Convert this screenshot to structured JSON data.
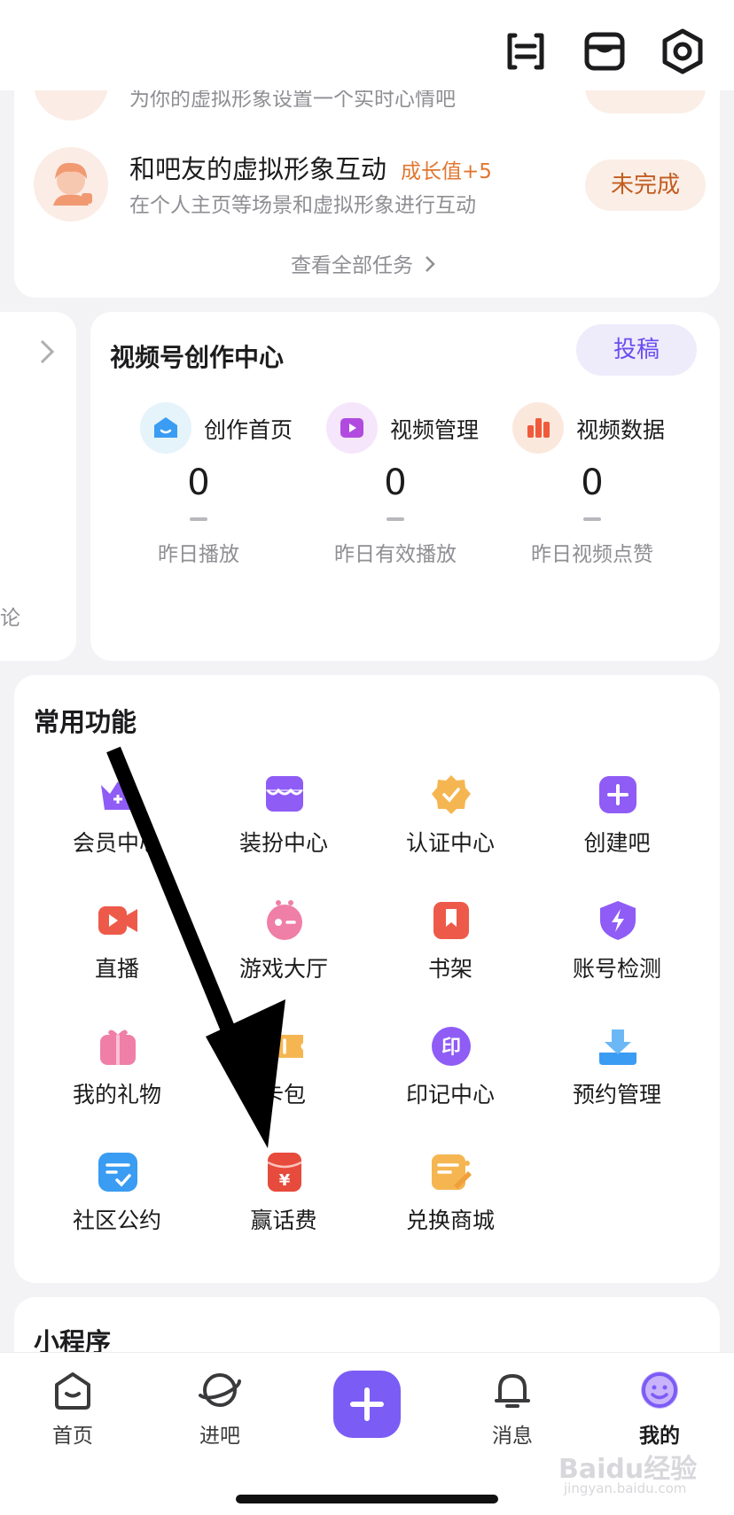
{
  "tasks": {
    "partial_subtitle": "为你的虚拟形象设置一个实时心情吧",
    "item": {
      "title": "和吧友的虚拟形象互动",
      "bonus": "成长值+5",
      "subtitle": "在个人主页等场景和虚拟形象进行互动",
      "status": "未完成"
    },
    "view_all": "查看全部任务"
  },
  "left_card": {
    "partial_text": "论"
  },
  "creator": {
    "title": "视频号创作中心",
    "submit": "投稿",
    "links": [
      {
        "label": "创作首页",
        "icon": "home-icon"
      },
      {
        "label": "视频管理",
        "icon": "video-manage-icon"
      },
      {
        "label": "视频数据",
        "icon": "bar-chart-icon"
      }
    ],
    "stats": [
      {
        "value": "0",
        "label": "昨日播放"
      },
      {
        "value": "0",
        "label": "昨日有效播放"
      },
      {
        "value": "0",
        "label": "昨日视频点赞"
      }
    ]
  },
  "features": {
    "title": "常用功能",
    "items": [
      {
        "label": "会员中心",
        "icon": "crown-icon"
      },
      {
        "label": "装扮中心",
        "icon": "box-icon"
      },
      {
        "label": "认证中心",
        "icon": "verified-badge-icon"
      },
      {
        "label": "创建吧",
        "icon": "plus-square-icon"
      },
      {
        "label": "直播",
        "icon": "video-camera-icon"
      },
      {
        "label": "游戏大厅",
        "icon": "gamepad-icon"
      },
      {
        "label": "书架",
        "icon": "bookmark-icon"
      },
      {
        "label": "账号检测",
        "icon": "shield-bolt-icon"
      },
      {
        "label": "我的礼物",
        "icon": "gift-icon"
      },
      {
        "label": "卡包",
        "icon": "ticket-icon"
      },
      {
        "label": "印记中心",
        "icon": "seal-icon"
      },
      {
        "label": "预约管理",
        "icon": "download-tray-icon"
      },
      {
        "label": "社区公约",
        "icon": "checklist-icon"
      },
      {
        "label": "赢话费",
        "icon": "red-envelope-icon"
      },
      {
        "label": "兑换商城",
        "icon": "exchange-note-icon"
      }
    ]
  },
  "mini_programs": {
    "title": "小程序"
  },
  "nav": {
    "items": [
      {
        "label": "首页",
        "icon": "home-tab-icon"
      },
      {
        "label": "进吧",
        "icon": "planet-icon"
      },
      {
        "label": "消息",
        "icon": "bell-icon"
      },
      {
        "label": "我的",
        "icon": "smiley-icon"
      }
    ],
    "active": "我的"
  },
  "watermark": {
    "text": "Baidu经验",
    "sub": "jingyan.baidu.com"
  },
  "colors": {
    "accent": "#7b5cf5",
    "orange": "#e0772f",
    "card": "#ffffff",
    "bg": "#f3f3f5"
  }
}
